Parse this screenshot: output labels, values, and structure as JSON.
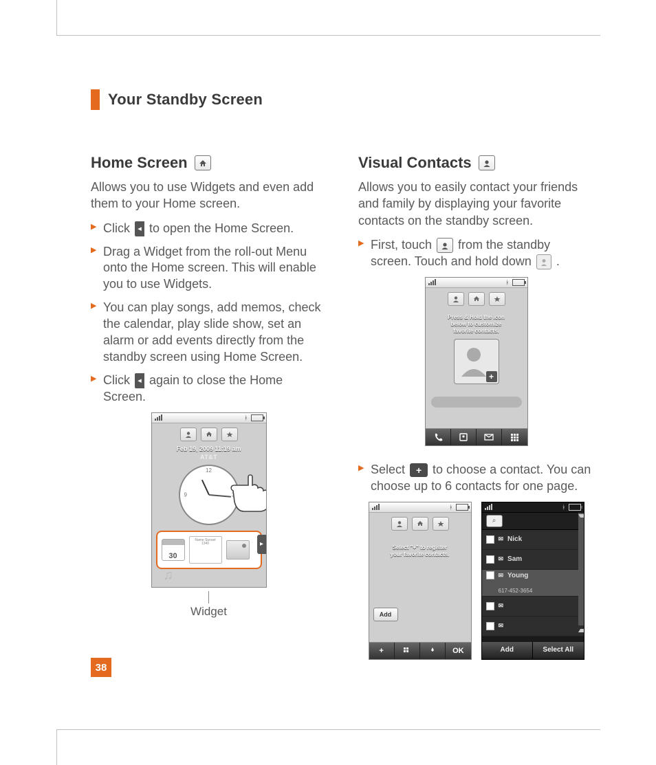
{
  "chapter": "Your Standby Screen",
  "page_number": "38",
  "left": {
    "heading": "Home Screen",
    "lead": "Allows you to use Widgets and even add them to your Home screen.",
    "steps": {
      "s1a": "Click ",
      "s1b": " to open the Home Screen.",
      "s2": "Drag a Widget from the roll-out Menu onto the Home screen. This will enable you to use Widgets.",
      "s3": "You can play songs, add memos, check the calendar, play slide show, set an alarm or add events directly from the standby screen using Home Screen.",
      "s4a": "Click ",
      "s4b": " again to close the Home Screen."
    },
    "figure": {
      "date": "Feb 19, 2009 11:19 am",
      "carrier": "AT&T",
      "cal_day": "30",
      "note_text": "Name\nSunset\n1340",
      "caption": "Widget"
    }
  },
  "right": {
    "heading": "Visual Contacts",
    "lead": "Allows you to easily contact your friends and family by displaying your favorite contacts on the standby screen.",
    "steps": {
      "s1a": "First, touch ",
      "s1b": " from the standby screen. Touch and hold down ",
      "s1c": ".",
      "s2a": "Select ",
      "s2b": " to choose a contact. You can choose up to 6 contacts for one page."
    },
    "fig1": {
      "msg_l1": "Press & Hold the icon",
      "msg_l2": "below to customize",
      "msg_l3": "favorite contacts."
    },
    "fig2_left": {
      "msg_l1": "Select \"+\" to register",
      "msg_l2": "your favorite contacts.",
      "add_label": "Add",
      "ok_label": "OK"
    },
    "fig2_right": {
      "rows": {
        "r1": "Nick",
        "r2": "Sam",
        "r3": "Young",
        "r3_sub": "617-452-3654"
      },
      "foot_add": "Add",
      "foot_sel": "Select All"
    }
  }
}
